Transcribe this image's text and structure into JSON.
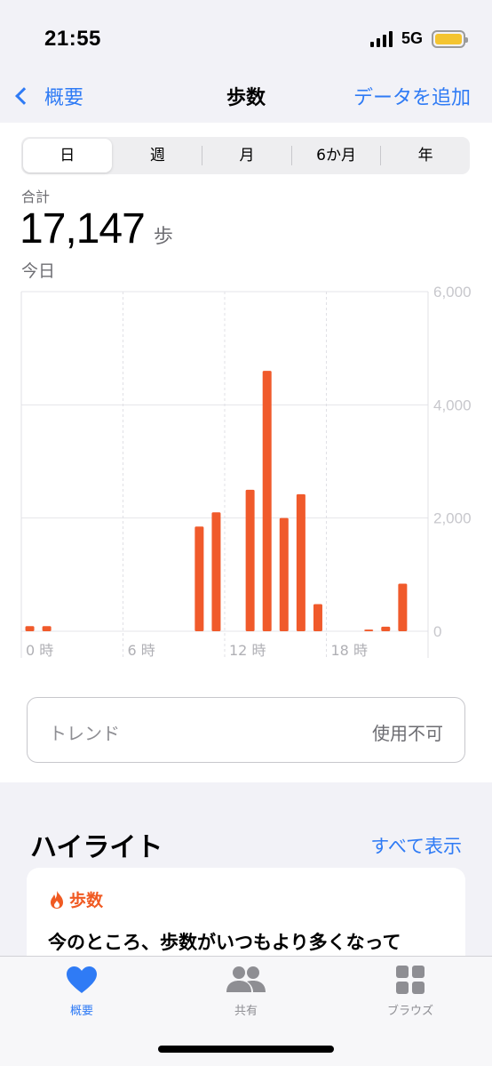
{
  "status": {
    "time": "21:55",
    "network": "5G"
  },
  "nav": {
    "back_label": "概要",
    "title": "歩数",
    "action_label": "データを追加"
  },
  "segments": [
    "日",
    "週",
    "月",
    "6か月",
    "年"
  ],
  "summary": {
    "label": "合計",
    "value": "17,147",
    "unit": "歩",
    "date": "今日"
  },
  "chart_data": {
    "type": "bar",
    "x_tick_labels": [
      "0 時",
      "6 時",
      "12 時",
      "18 時"
    ],
    "y_tick_labels": [
      "0",
      "2,000",
      "4,000",
      "6,000"
    ],
    "ylim": [
      0,
      6000
    ],
    "x_domain_hours": [
      0,
      24
    ],
    "hours": [
      0,
      1,
      2,
      3,
      4,
      5,
      6,
      7,
      8,
      9,
      10,
      11,
      12,
      13,
      14,
      15,
      16,
      17,
      18,
      19,
      20,
      21,
      22,
      23
    ],
    "values": [
      90,
      90,
      0,
      0,
      0,
      0,
      0,
      0,
      0,
      0,
      1850,
      2100,
      0,
      2500,
      4600,
      2000,
      2420,
      480,
      0,
      0,
      30,
      80,
      840,
      0
    ],
    "bar_color": "#f05a2b",
    "grid": true
  },
  "trend": {
    "label": "トレンド",
    "status": "使用不可"
  },
  "highlights": {
    "title": "ハイライト",
    "link": "すべて表示",
    "card_category": "歩数",
    "card_text": "今のところ、歩数がいつもより多くなって"
  },
  "tabs": [
    {
      "label": "概要",
      "icon": "heart-icon"
    },
    {
      "label": "共有",
      "icon": "people-icon"
    },
    {
      "label": "ブラウズ",
      "icon": "grid-icon"
    }
  ],
  "colors": {
    "accent": "#2f7bf5",
    "steps": "#f05a22",
    "battery": "#f4c430"
  }
}
